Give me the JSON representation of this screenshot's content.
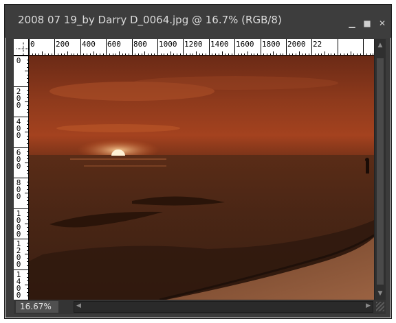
{
  "window": {
    "title": "2008 07 19_by Darry D_0064.jpg @ 16.7% (RGB/8)",
    "minimize_icon": "minimize-icon",
    "maximize_icon": "maximize-icon",
    "close_icon": "close-icon"
  },
  "rulers": {
    "horizontal_labels": [
      "0",
      "200",
      "400",
      "600",
      "800",
      "1000",
      "1200",
      "1400",
      "1600",
      "1800",
      "2000",
      "22"
    ],
    "vertical_labels": [
      "0",
      "200",
      "400",
      "600",
      "800",
      "1000",
      "1200",
      "1400"
    ]
  },
  "status": {
    "zoom": "16.67%"
  },
  "image": {
    "description_icon": "sunset-photo",
    "colors": {
      "sky_top": "#6b2a16",
      "sky_mid": "#a4421f",
      "sun": "#fff2d6",
      "sea": "#4a2615",
      "sand": "#8a5636"
    }
  }
}
